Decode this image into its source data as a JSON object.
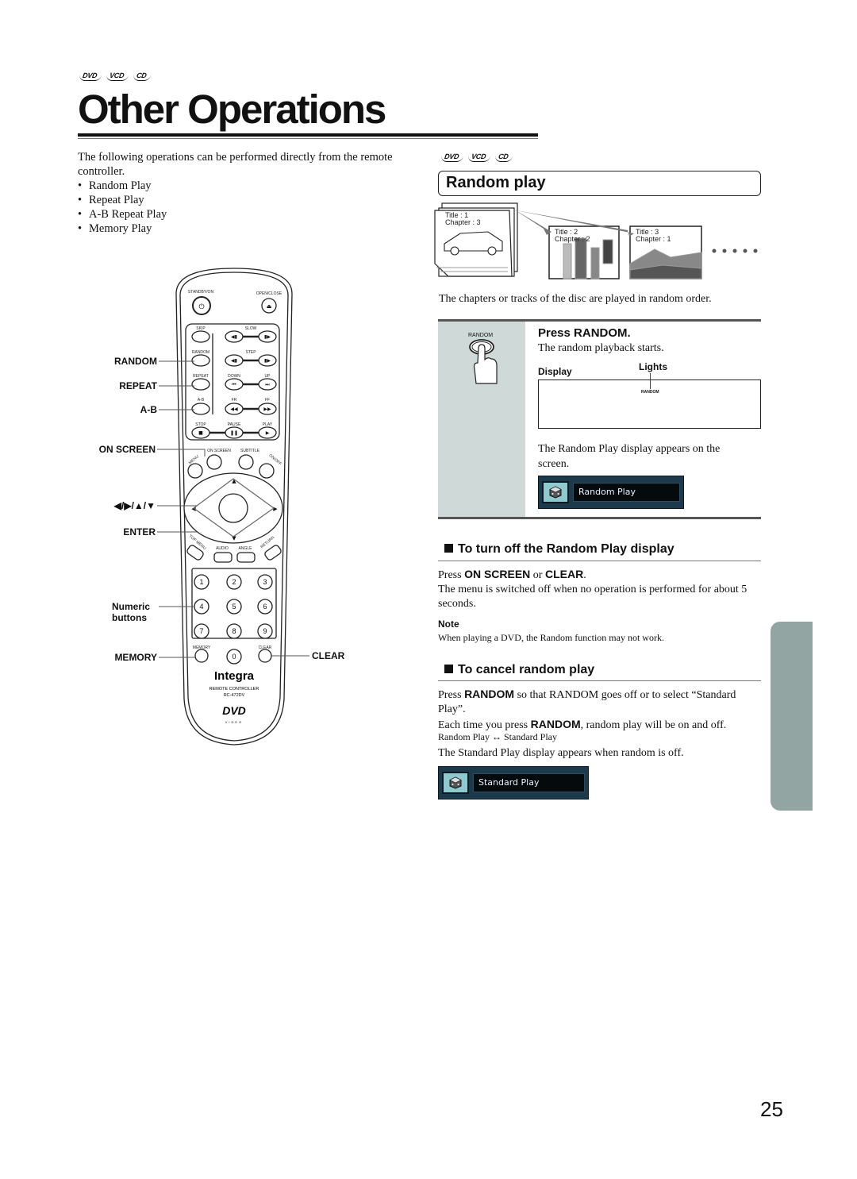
{
  "disc_badges": [
    "DVD",
    "VCD",
    "CD"
  ],
  "page_title": "Other Operations",
  "intro": {
    "text": "The following operations can be performed directly from the remote controller.",
    "items": [
      "Random Play",
      "Repeat Play",
      "A-B Repeat Play",
      "Memory Play"
    ]
  },
  "remote": {
    "callouts": {
      "random": "RANDOM",
      "repeat": "REPEAT",
      "ab": "A-B",
      "on_screen": "ON SCREEN",
      "arrows": "◀/▶/▲/▼",
      "enter": "ENTER",
      "numeric": "Numeric buttons",
      "memory": "MEMORY",
      "clear": "CLEAR"
    },
    "button_labels": {
      "standby": "STANDBY/ON",
      "open_close": "OPEN/CLOSE",
      "skip": "SKIP",
      "slow": "SLOW",
      "random": "RANDOM",
      "step": "STEP",
      "repeat": "REPEAT",
      "down": "DOWN",
      "up": "UP",
      "ab": "A-B",
      "fr": "FR",
      "ff": "FF",
      "stop": "STOP",
      "pause": "PAUSE",
      "play": "PLAY",
      "menu": "MENU",
      "on_screen": "ON SCREEN",
      "subtitle": "SUBTITLE",
      "on_off": "ON/OFF",
      "enter": "ENTER",
      "top_menu": "TOP MENU",
      "audio": "AUDIO",
      "angle": "ANGLE",
      "return": "RETURN",
      "memory": "MEMORY",
      "clear": "CLEAR",
      "digits": [
        "1",
        "2",
        "3",
        "4",
        "5",
        "6",
        "7",
        "8",
        "9",
        "0"
      ]
    },
    "brand": "Integra",
    "model_line1": "REMOTE CONTROLLER",
    "model_line2": "RC-472DV",
    "dvd_logo": "DVD",
    "dvd_sub": "VIDEO"
  },
  "random_play": {
    "heading": "Random play",
    "scenes": [
      {
        "title": "Title : 1",
        "chapter": "Chapter : 3"
      },
      {
        "title": "Title : 2",
        "chapter": "Chapter : 2"
      },
      {
        "title": "Title : 3",
        "chapter": "Chapter : 1"
      }
    ],
    "caption": "The chapters or tracks of the disc are played in random order.",
    "step": {
      "button_label": "RANDOM",
      "title": "Press RANDOM.",
      "subtitle": "The random playback starts.",
      "display_label": "Display",
      "lights_label": "Lights",
      "indicator": "RANDOM",
      "screen_note": "The Random Play display appears on the screen.",
      "osd_text": "Random Play"
    }
  },
  "turn_off": {
    "heading": "To turn off the Random Play display",
    "press_prefix": "Press ",
    "key1": "ON SCREEN",
    "or": " or ",
    "key2": "CLEAR",
    "period": ".",
    "body": "The menu is switched off when no operation is performed for about 5 seconds.",
    "note_label": "Note",
    "note_text": "When playing a DVD, the Random function may not work."
  },
  "cancel": {
    "heading": "To cancel random play",
    "p1_prefix": "Press ",
    "p1_key": "RANDOM",
    "p1_suffix": " so that RANDOM goes off or to select “Standard Play”.",
    "p2_prefix": "Each time you press ",
    "p2_key": "RANDOM",
    "p2_suffix": ", random play will be on and off.",
    "toggle": "Random Play ↔ Standard Play",
    "std_note": "The Standard Play display appears when random is off.",
    "osd_text": "Standard Play"
  },
  "page_number": "25"
}
